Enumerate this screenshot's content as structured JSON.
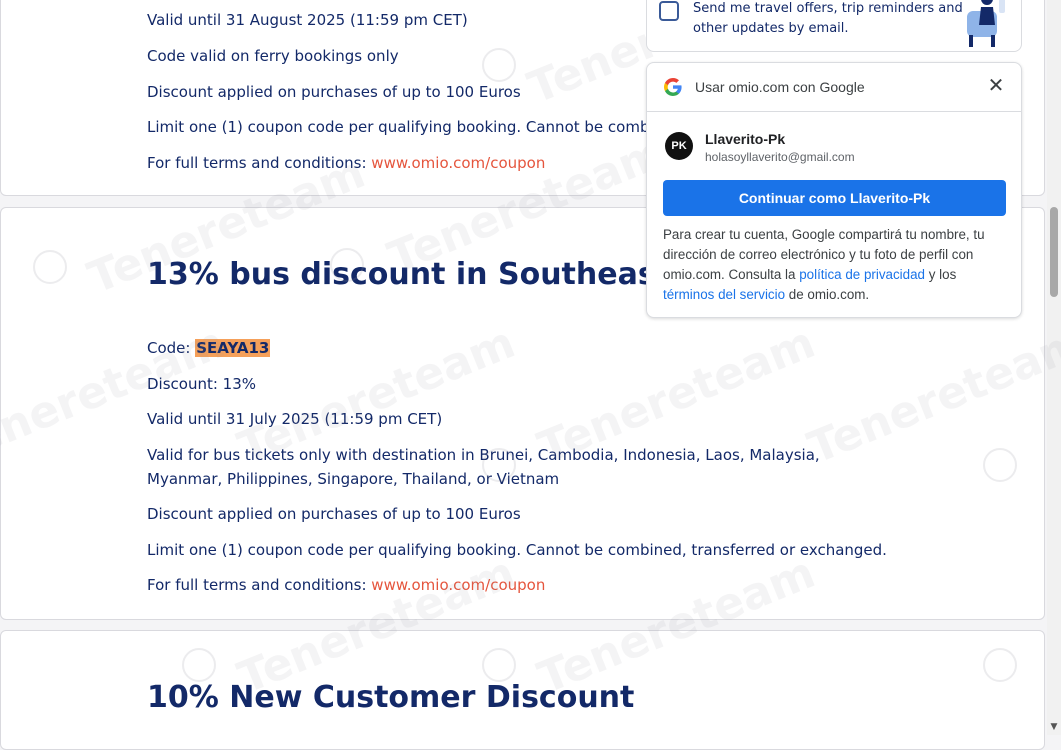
{
  "card1": {
    "lines": [
      "Valid until 31 August 2025 (11:59 pm CET)",
      "Code valid on ferry bookings only",
      "Discount applied on purchases of up to 100 Euros",
      "Limit one (1) coupon code per qualifying booking. Cannot be combine"
    ],
    "terms_prefix": "For full terms and conditions: ",
    "terms_link": "www.omio.com/coupon"
  },
  "card2": {
    "heading": "13% bus discount in Southeast As",
    "code_prefix": "Code: ",
    "code": "SEAYA13",
    "discount": "Discount: 13%",
    "valid": "Valid until 31 July 2025 (11:59 pm CET)",
    "destinations": "Valid for bus tickets only with destination in Brunei, Cambodia, Indonesia, Laos, Malaysia, Myanmar, Philippines, Singapore, Thailand, or Vietnam",
    "discount_limit": "Discount applied on purchases of up to 100 Euros",
    "limit": "Limit one (1) coupon code per qualifying booking. Cannot be combined, transferred or exchanged.",
    "terms_prefix": "For full terms and conditions: ",
    "terms_link": "www.omio.com/coupon"
  },
  "card3": {
    "heading": "10% New Customer Discount"
  },
  "offers": {
    "text": "Send me travel offers, trip reminders and other updates by email."
  },
  "google": {
    "title": "Usar omio.com con Google",
    "avatar_initials": "PK",
    "name": "Llaverito-Pk",
    "email": "holasoyllaverito@gmail.com",
    "continue_label": "Continuar como Llaverito-Pk",
    "text_1": "Para crear tu cuenta, Google compartirá tu nombre, tu dirección de correo electrónico y tu foto de perfil con omio.com. Consulta la ",
    "privacy_link": "política de privacidad",
    "text_2": " y los ",
    "terms_link": "términos del servicio",
    "text_3": " de omio.com."
  },
  "watermark": "Tenereteam",
  "colors": {
    "heading": "#132968",
    "link": "#e5553d",
    "google_blue": "#1a73e8",
    "code_highlight": "#f5a05a"
  }
}
